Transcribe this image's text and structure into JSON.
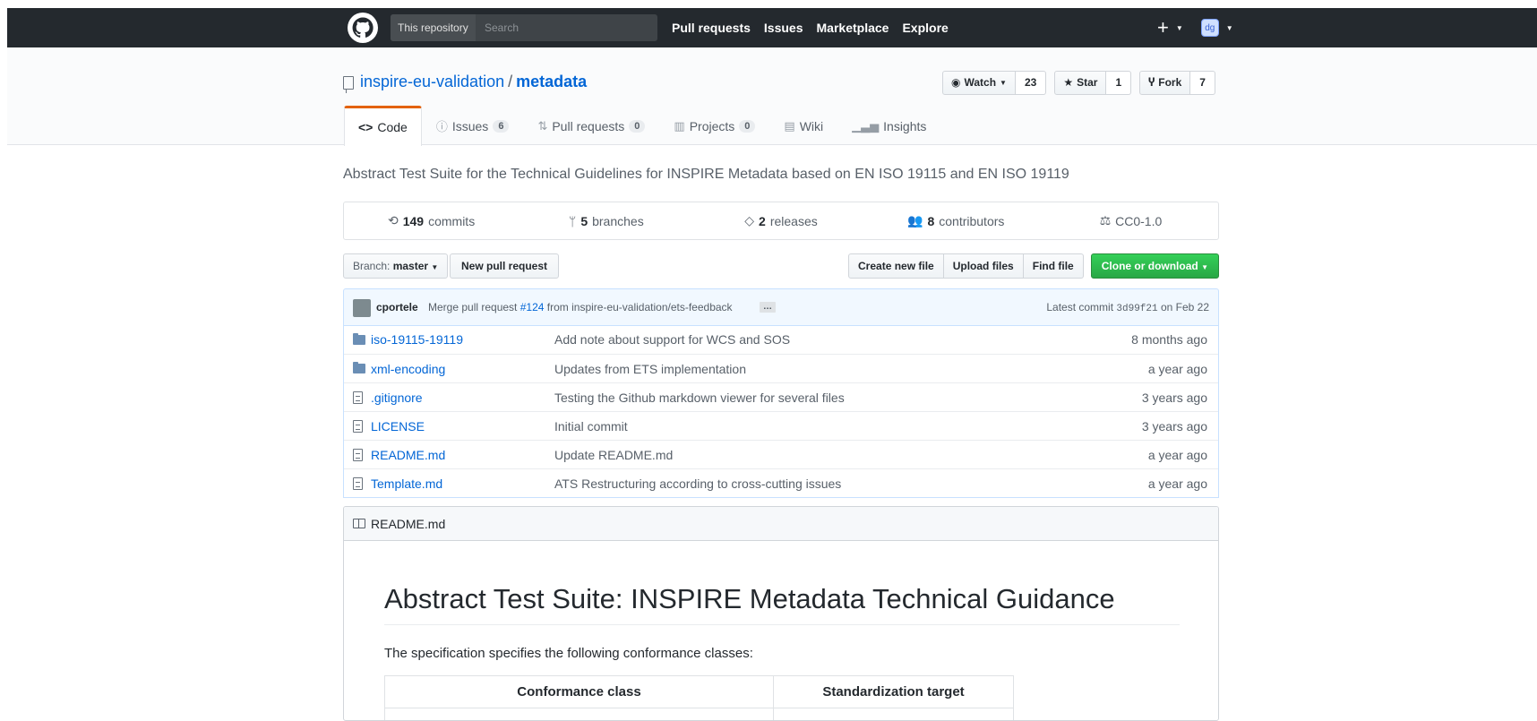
{
  "header": {
    "search_scope": "This repository",
    "search_placeholder": "Search",
    "nav": [
      "Pull requests",
      "Issues",
      "Marketplace",
      "Explore"
    ],
    "new_icon": "plus-icon",
    "avatar_initials": "dg"
  },
  "repo": {
    "owner": "inspire-eu-validation",
    "name": "metadata",
    "watch_label": "Watch",
    "watch_count": "23",
    "star_label": "Star",
    "star_count": "1",
    "fork_label": "Fork",
    "fork_count": "7",
    "tabs": [
      {
        "label": "Code",
        "icon": "code-icon",
        "count": null
      },
      {
        "label": "Issues",
        "icon": "issue-icon",
        "count": "6"
      },
      {
        "label": "Pull requests",
        "icon": "pull-request-icon",
        "count": "0"
      },
      {
        "label": "Projects",
        "icon": "project-icon",
        "count": "0"
      },
      {
        "label": "Wiki",
        "icon": "wiki-icon",
        "count": null
      },
      {
        "label": "Insights",
        "icon": "graph-icon",
        "count": null
      }
    ]
  },
  "description": "Abstract Test Suite for the Technical Guidelines for INSPIRE Metadata based on EN ISO 19115 and EN ISO 19119",
  "summary": {
    "commits_count": "149",
    "commits_label": "commits",
    "branches_count": "5",
    "branches_label": "branches",
    "releases_count": "2",
    "releases_label": "releases",
    "contributors_count": "8",
    "contributors_label": "contributors",
    "license": "CC0-1.0"
  },
  "file_nav": {
    "branch_prefix": "Branch:",
    "branch_name": "master",
    "new_pull_request": "New pull request",
    "create_new_file": "Create new file",
    "upload_files": "Upload files",
    "find_file": "Find file",
    "clone_or_download": "Clone or download"
  },
  "commit": {
    "author": "cportele",
    "message_prefix": "Merge pull request",
    "pr_link": "#124",
    "message_suffix": "from inspire-eu-validation/ets-feedback",
    "ellipsis": "…",
    "latest_label": "Latest commit",
    "sha": "3d99f21",
    "date": "on Feb 22"
  },
  "files": [
    {
      "type": "dir",
      "name": "iso-19115-19119",
      "message": "Add note about support for WCS and SOS",
      "age": "8 months ago"
    },
    {
      "type": "dir",
      "name": "xml-encoding",
      "message": "Updates from ETS implementation",
      "age": "a year ago"
    },
    {
      "type": "file",
      "name": ".gitignore",
      "message": "Testing the Github markdown viewer for several files",
      "age": "3 years ago"
    },
    {
      "type": "file",
      "name": "LICENSE",
      "message": "Initial commit",
      "age": "3 years ago"
    },
    {
      "type": "file",
      "name": "README.md",
      "message": "Update README.md",
      "age": "a year ago"
    },
    {
      "type": "file",
      "name": "Template.md",
      "message": "ATS Restructuring according to cross-cutting issues",
      "age": "a year ago"
    }
  ],
  "readme": {
    "file_label": "README.md",
    "title": "Abstract Test Suite: INSPIRE Metadata Technical Guidance",
    "paragraph": "The specification specifies the following conformance classes:",
    "table_headers": [
      "Conformance class",
      "Standardization target"
    ]
  },
  "colors": {
    "topbar": "#24292e",
    "link": "#0366d6",
    "selected_tab_accent": "#e36209",
    "clone_button": "#28a745"
  }
}
